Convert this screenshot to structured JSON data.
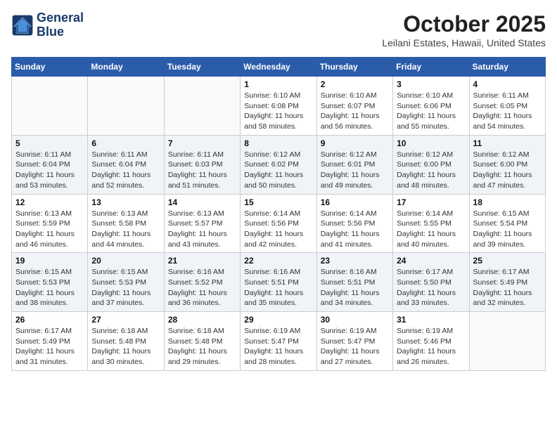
{
  "header": {
    "logo_line1": "General",
    "logo_line2": "Blue",
    "month": "October 2025",
    "location": "Leilani Estates, Hawaii, United States"
  },
  "weekdays": [
    "Sunday",
    "Monday",
    "Tuesday",
    "Wednesday",
    "Thursday",
    "Friday",
    "Saturday"
  ],
  "weeks": [
    [
      {
        "day": "",
        "sunrise": "",
        "sunset": "",
        "daylight": ""
      },
      {
        "day": "",
        "sunrise": "",
        "sunset": "",
        "daylight": ""
      },
      {
        "day": "",
        "sunrise": "",
        "sunset": "",
        "daylight": ""
      },
      {
        "day": "1",
        "sunrise": "Sunrise: 6:10 AM",
        "sunset": "Sunset: 6:08 PM",
        "daylight": "Daylight: 11 hours and 58 minutes."
      },
      {
        "day": "2",
        "sunrise": "Sunrise: 6:10 AM",
        "sunset": "Sunset: 6:07 PM",
        "daylight": "Daylight: 11 hours and 56 minutes."
      },
      {
        "day": "3",
        "sunrise": "Sunrise: 6:10 AM",
        "sunset": "Sunset: 6:06 PM",
        "daylight": "Daylight: 11 hours and 55 minutes."
      },
      {
        "day": "4",
        "sunrise": "Sunrise: 6:11 AM",
        "sunset": "Sunset: 6:05 PM",
        "daylight": "Daylight: 11 hours and 54 minutes."
      }
    ],
    [
      {
        "day": "5",
        "sunrise": "Sunrise: 6:11 AM",
        "sunset": "Sunset: 6:04 PM",
        "daylight": "Daylight: 11 hours and 53 minutes."
      },
      {
        "day": "6",
        "sunrise": "Sunrise: 6:11 AM",
        "sunset": "Sunset: 6:04 PM",
        "daylight": "Daylight: 11 hours and 52 minutes."
      },
      {
        "day": "7",
        "sunrise": "Sunrise: 6:11 AM",
        "sunset": "Sunset: 6:03 PM",
        "daylight": "Daylight: 11 hours and 51 minutes."
      },
      {
        "day": "8",
        "sunrise": "Sunrise: 6:12 AM",
        "sunset": "Sunset: 6:02 PM",
        "daylight": "Daylight: 11 hours and 50 minutes."
      },
      {
        "day": "9",
        "sunrise": "Sunrise: 6:12 AM",
        "sunset": "Sunset: 6:01 PM",
        "daylight": "Daylight: 11 hours and 49 minutes."
      },
      {
        "day": "10",
        "sunrise": "Sunrise: 6:12 AM",
        "sunset": "Sunset: 6:00 PM",
        "daylight": "Daylight: 11 hours and 48 minutes."
      },
      {
        "day": "11",
        "sunrise": "Sunrise: 6:12 AM",
        "sunset": "Sunset: 6:00 PM",
        "daylight": "Daylight: 11 hours and 47 minutes."
      }
    ],
    [
      {
        "day": "12",
        "sunrise": "Sunrise: 6:13 AM",
        "sunset": "Sunset: 5:59 PM",
        "daylight": "Daylight: 11 hours and 46 minutes."
      },
      {
        "day": "13",
        "sunrise": "Sunrise: 6:13 AM",
        "sunset": "Sunset: 5:58 PM",
        "daylight": "Daylight: 11 hours and 44 minutes."
      },
      {
        "day": "14",
        "sunrise": "Sunrise: 6:13 AM",
        "sunset": "Sunset: 5:57 PM",
        "daylight": "Daylight: 11 hours and 43 minutes."
      },
      {
        "day": "15",
        "sunrise": "Sunrise: 6:14 AM",
        "sunset": "Sunset: 5:56 PM",
        "daylight": "Daylight: 11 hours and 42 minutes."
      },
      {
        "day": "16",
        "sunrise": "Sunrise: 6:14 AM",
        "sunset": "Sunset: 5:56 PM",
        "daylight": "Daylight: 11 hours and 41 minutes."
      },
      {
        "day": "17",
        "sunrise": "Sunrise: 6:14 AM",
        "sunset": "Sunset: 5:55 PM",
        "daylight": "Daylight: 11 hours and 40 minutes."
      },
      {
        "day": "18",
        "sunrise": "Sunrise: 6:15 AM",
        "sunset": "Sunset: 5:54 PM",
        "daylight": "Daylight: 11 hours and 39 minutes."
      }
    ],
    [
      {
        "day": "19",
        "sunrise": "Sunrise: 6:15 AM",
        "sunset": "Sunset: 5:53 PM",
        "daylight": "Daylight: 11 hours and 38 minutes."
      },
      {
        "day": "20",
        "sunrise": "Sunrise: 6:15 AM",
        "sunset": "Sunset: 5:53 PM",
        "daylight": "Daylight: 11 hours and 37 minutes."
      },
      {
        "day": "21",
        "sunrise": "Sunrise: 6:16 AM",
        "sunset": "Sunset: 5:52 PM",
        "daylight": "Daylight: 11 hours and 36 minutes."
      },
      {
        "day": "22",
        "sunrise": "Sunrise: 6:16 AM",
        "sunset": "Sunset: 5:51 PM",
        "daylight": "Daylight: 11 hours and 35 minutes."
      },
      {
        "day": "23",
        "sunrise": "Sunrise: 6:16 AM",
        "sunset": "Sunset: 5:51 PM",
        "daylight": "Daylight: 11 hours and 34 minutes."
      },
      {
        "day": "24",
        "sunrise": "Sunrise: 6:17 AM",
        "sunset": "Sunset: 5:50 PM",
        "daylight": "Daylight: 11 hours and 33 minutes."
      },
      {
        "day": "25",
        "sunrise": "Sunrise: 6:17 AM",
        "sunset": "Sunset: 5:49 PM",
        "daylight": "Daylight: 11 hours and 32 minutes."
      }
    ],
    [
      {
        "day": "26",
        "sunrise": "Sunrise: 6:17 AM",
        "sunset": "Sunset: 5:49 PM",
        "daylight": "Daylight: 11 hours and 31 minutes."
      },
      {
        "day": "27",
        "sunrise": "Sunrise: 6:18 AM",
        "sunset": "Sunset: 5:48 PM",
        "daylight": "Daylight: 11 hours and 30 minutes."
      },
      {
        "day": "28",
        "sunrise": "Sunrise: 6:18 AM",
        "sunset": "Sunset: 5:48 PM",
        "daylight": "Daylight: 11 hours and 29 minutes."
      },
      {
        "day": "29",
        "sunrise": "Sunrise: 6:19 AM",
        "sunset": "Sunset: 5:47 PM",
        "daylight": "Daylight: 11 hours and 28 minutes."
      },
      {
        "day": "30",
        "sunrise": "Sunrise: 6:19 AM",
        "sunset": "Sunset: 5:47 PM",
        "daylight": "Daylight: 11 hours and 27 minutes."
      },
      {
        "day": "31",
        "sunrise": "Sunrise: 6:19 AM",
        "sunset": "Sunset: 5:46 PM",
        "daylight": "Daylight: 11 hours and 26 minutes."
      },
      {
        "day": "",
        "sunrise": "",
        "sunset": "",
        "daylight": ""
      }
    ]
  ]
}
